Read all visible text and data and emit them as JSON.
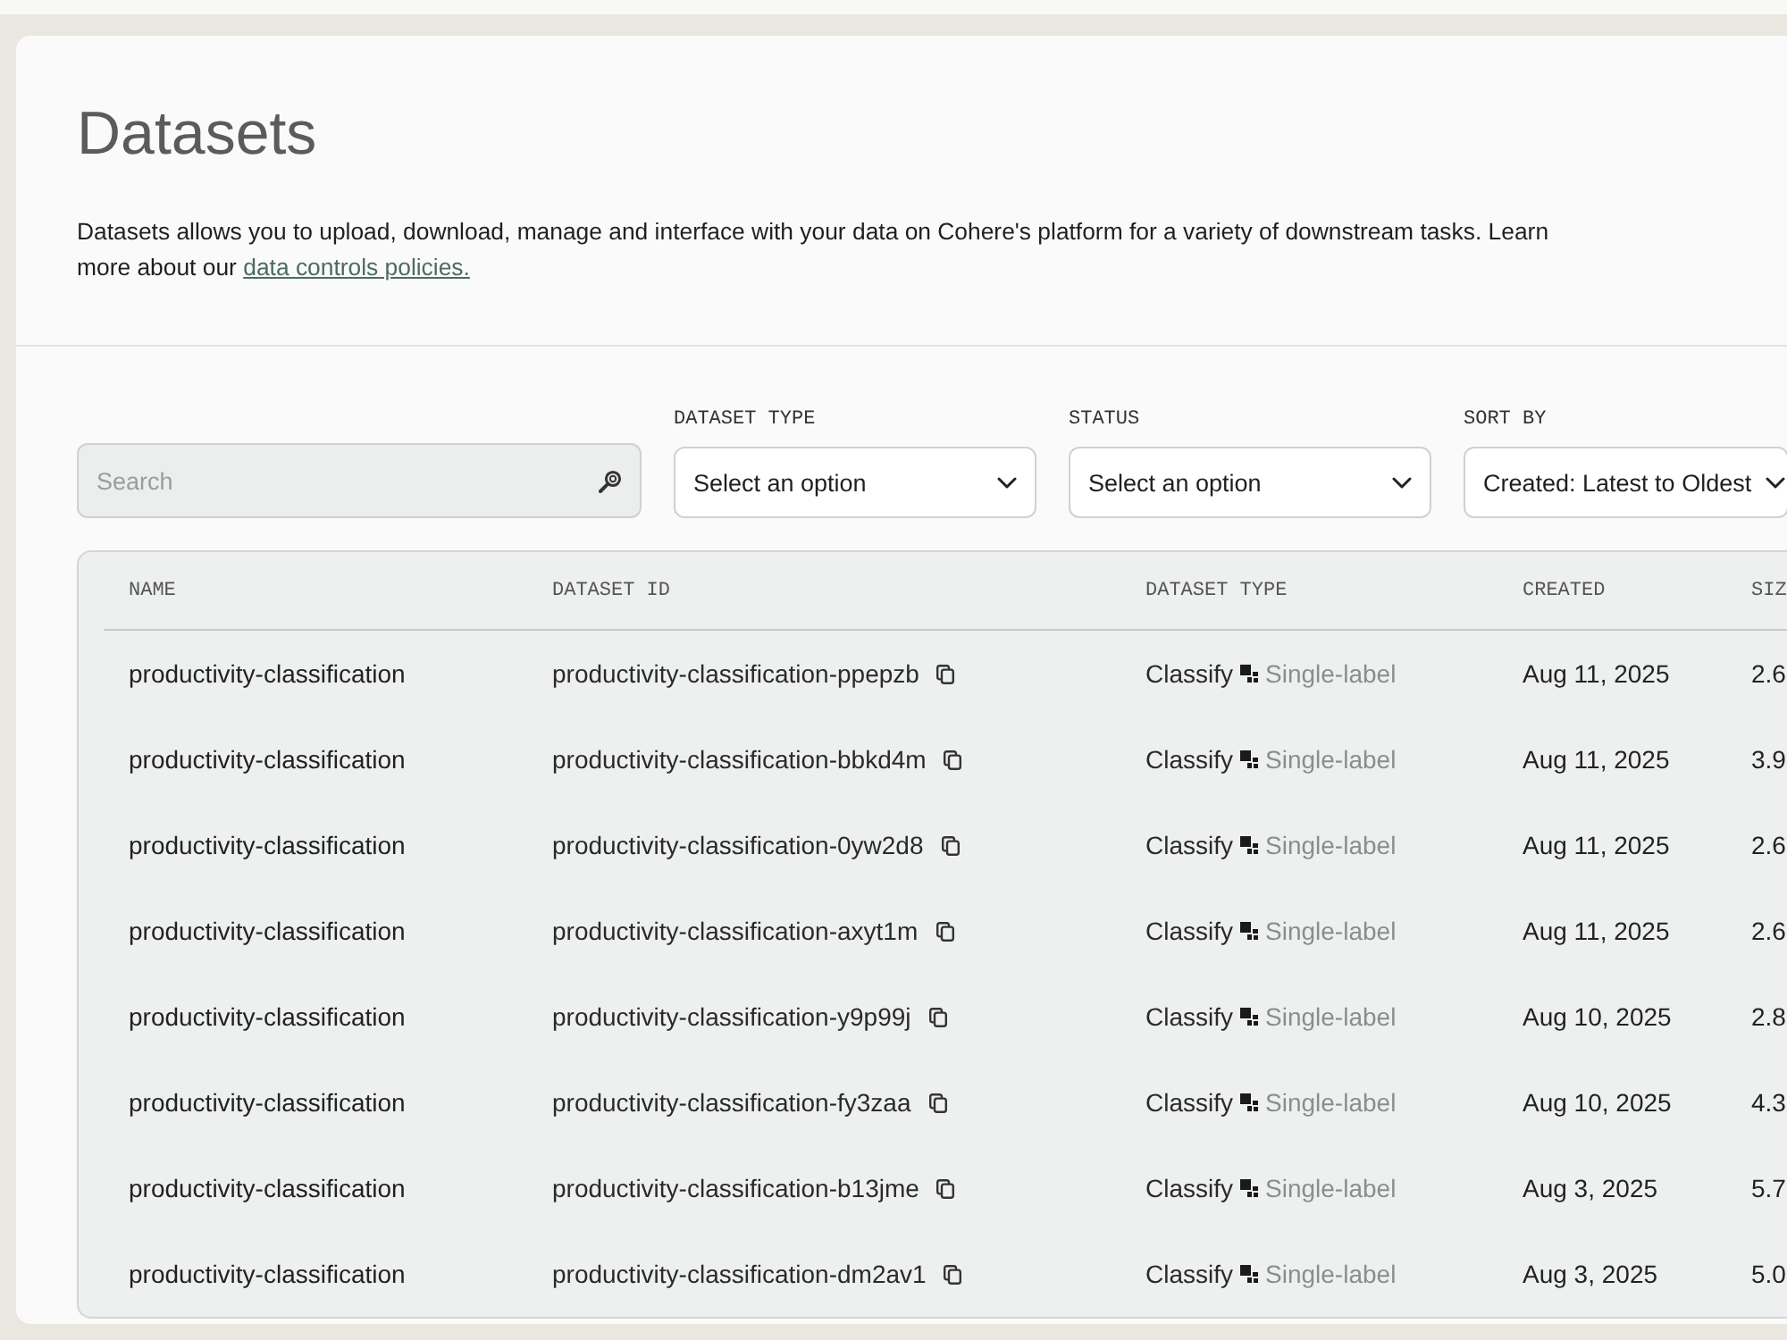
{
  "header": {
    "title": "Datasets",
    "description": "Datasets allows you to upload, download, manage and interface with your data on Cohere's platform for a variety of downstream tasks. Learn more about our",
    "link": "data controls policies."
  },
  "filters": {
    "search": {
      "placeholder": "Search"
    },
    "selects": [
      {
        "label": "DATASET TYPE",
        "placeholder": "Select an option"
      },
      {
        "label": "STATUS",
        "placeholder": "Select an option"
      },
      {
        "label": "SORT BY",
        "value": "Created: Latest to Oldest"
      }
    ]
  },
  "table": {
    "columns": [
      "NAME",
      "DATASET ID",
      "DATASET TYPE",
      "CREATED",
      "SIZ"
    ],
    "rows": [
      {
        "name": "productivity-classification",
        "dataset_id": "productivity-classification-ppepzb",
        "type": "Classify",
        "subtype": "Single-label",
        "created": "Aug 11, 2025",
        "size": "2.6"
      },
      {
        "name": "productivity-classification",
        "dataset_id": "productivity-classification-bbkd4m",
        "type": "Classify",
        "subtype": "Single-label",
        "created": "Aug 11, 2025",
        "size": "3.9"
      },
      {
        "name": "productivity-classification",
        "dataset_id": "productivity-classification-0yw2d8",
        "type": "Classify",
        "subtype": "Single-label",
        "created": "Aug 11, 2025",
        "size": "2.6"
      },
      {
        "name": "productivity-classification",
        "dataset_id": "productivity-classification-axyt1m",
        "type": "Classify",
        "subtype": "Single-label",
        "created": "Aug 11, 2025",
        "size": "2.6"
      },
      {
        "name": "productivity-classification",
        "dataset_id": "productivity-classification-y9p99j",
        "type": "Classify",
        "subtype": "Single-label",
        "created": "Aug 10, 2025",
        "size": "2.8"
      },
      {
        "name": "productivity-classification",
        "dataset_id": "productivity-classification-fy3zaa",
        "type": "Classify",
        "subtype": "Single-label",
        "created": "Aug 10, 2025",
        "size": "4.3"
      },
      {
        "name": "productivity-classification",
        "dataset_id": "productivity-classification-b13jme",
        "type": "Classify",
        "subtype": "Single-label",
        "created": "Aug 3, 2025",
        "size": "5.7"
      },
      {
        "name": "productivity-classification",
        "dataset_id": "productivity-classification-dm2av1",
        "type": "Classify",
        "subtype": "Single-label",
        "created": "Aug 3, 2025",
        "size": "5.0"
      }
    ]
  }
}
